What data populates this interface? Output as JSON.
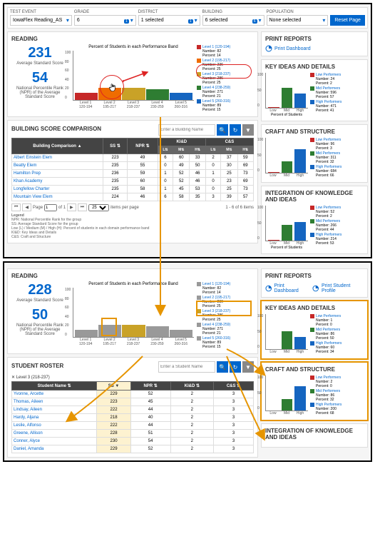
{
  "filters": {
    "test_event": {
      "label": "TEST EVENT",
      "value": "IowaFlex Reading_AS"
    },
    "grade": {
      "label": "GRADE",
      "value": "6",
      "badge": "1"
    },
    "district": {
      "label": "DISTRICT",
      "value": "1 selected",
      "badge": "1"
    },
    "building": {
      "label": "BUILDING",
      "value": "6 selected",
      "badge": "6"
    },
    "population": {
      "label": "POPULATION",
      "value": "None selected"
    },
    "reset": "Reset Page"
  },
  "top": {
    "reading_title": "READING",
    "avg_score": "231",
    "avg_label": "Average Standard Score",
    "npr": "54",
    "npr_label": "National Percentile Rank (NPR) of the Average Standard Score",
    "chart_title": "Percent of Students in each Performance Band",
    "levels": [
      {
        "name": "Level 1 (120-194)",
        "range": "120-194",
        "number": "82",
        "percent": "14",
        "color": "#c62828",
        "height": 14
      },
      {
        "name": "Level 2 (195-217)",
        "range": "195-217",
        "number": "236",
        "percent": "25",
        "color": "#ef6c00",
        "height": 25
      },
      {
        "name": "Level 3 (218-237)",
        "range": "218-237",
        "number": "286",
        "percent": "25",
        "color": "#c9a227",
        "height": 25
      },
      {
        "name": "Level 4 (238-259)",
        "range": "230-259",
        "number": "271",
        "percent": "21",
        "color": "#2e7d32",
        "height": 21
      },
      {
        "name": "Level 5 (260-316)",
        "range": "260-316",
        "number": "89",
        "percent": "15",
        "color": "#1565c0",
        "height": 15
      }
    ],
    "bsc_title": "BUILDING SCORE COMPARISON",
    "search_ph": "Enter a Building Name",
    "cols": {
      "building": "Building Comparison",
      "ss": "SS",
      "npr": "NPR",
      "kid": "KI&D",
      "cs": "C&S",
      "l": "L",
      "m": "M",
      "h": "H"
    },
    "rows": [
      {
        "name": "Albert Einstein Elem",
        "ss": "223",
        "npr": "49",
        "kl": "6",
        "km": "60",
        "kh": "33",
        "cl": "2",
        "cm": "37",
        "ch": "59"
      },
      {
        "name": "Beatty Elem",
        "ss": "235",
        "npr": "55",
        "kl": "0",
        "km": "49",
        "kh": "50",
        "cl": "0",
        "cm": "30",
        "ch": "69"
      },
      {
        "name": "Hamilton Prep",
        "ss": "236",
        "npr": "59",
        "kl": "1",
        "km": "52",
        "kh": "46",
        "cl": "1",
        "cm": "25",
        "ch": "73"
      },
      {
        "name": "Khan Academy",
        "ss": "235",
        "npr": "60",
        "kl": "0",
        "km": "52",
        "kh": "46",
        "cl": "0",
        "cm": "23",
        "ch": "69"
      },
      {
        "name": "Longfellow Charter",
        "ss": "235",
        "npr": "58",
        "kl": "1",
        "km": "45",
        "kh": "53",
        "cl": "0",
        "cm": "25",
        "ch": "73"
      },
      {
        "name": "Mountain View Elem",
        "ss": "224",
        "npr": "46",
        "kl": "6",
        "km": "58",
        "kh": "35",
        "cl": "3",
        "cm": "39",
        "ch": "57"
      }
    ],
    "pager": {
      "page": "Page",
      "of": "of 1",
      "ipp": "items per page",
      "count": "1 - 6 of 6 items",
      "ppv": "25",
      "pg": "1"
    },
    "legend_title": "Legend",
    "legend_lines": [
      "NPR: National Percentile Rank for the group",
      "SS: Average Standard Score for the group",
      "Low (L) / Medium (M) / High (H): Percent of students in each domain performance band",
      "KI&D: Key Ideas and Details",
      "C&S: Craft and Structure"
    ],
    "print_title": "PRINT REPORTS",
    "print_dash": "Print Dashboard",
    "key_ideas": {
      "title": "KEY IDEAS AND DETAILS",
      "xlabel": "Percent of Students",
      "perf": [
        {
          "name": "Low Performers",
          "number": "24",
          "percent": "2",
          "color": "#c62828",
          "h": 2
        },
        {
          "name": "Mid Performers",
          "number": "596",
          "percent": "57",
          "color": "#2e7d32",
          "h": 57
        },
        {
          "name": "High Performers",
          "number": "471",
          "percent": "41",
          "color": "#1565c0",
          "h": 41
        }
      ],
      "xlabels": [
        "Low",
        "Mid",
        "High"
      ]
    },
    "craft": {
      "title": "CRAFT AND STRUCTURE",
      "perf": [
        {
          "name": "Low Performers",
          "number": "96",
          "percent": "3",
          "color": "#c62828",
          "h": 3
        },
        {
          "name": "Mid Performers",
          "number": "311",
          "percent": "32",
          "color": "#2e7d32",
          "h": 32
        },
        {
          "name": "High Performers",
          "number": "684",
          "percent": "66",
          "color": "#1565c0",
          "h": 66
        }
      ]
    },
    "integ": {
      "title": "INTEGRATION OF KNOWLEDGE AND IDEAS",
      "perf": [
        {
          "name": "Low Performers",
          "number": "52",
          "percent": "2",
          "color": "#c62828",
          "h": 2
        },
        {
          "name": "Mid Performers",
          "number": "266",
          "percent": "44",
          "color": "#2e7d32",
          "h": 44
        },
        {
          "name": "High Performers",
          "number": "214",
          "percent": "53",
          "color": "#1565c0",
          "h": 53
        }
      ]
    }
  },
  "bottom": {
    "avg_score": "228",
    "npr": "50",
    "levels": [
      {
        "name": "Level 1 (120-194)",
        "range": "120-194",
        "number": "82",
        "percent": "14",
        "color": "#999",
        "height": 14
      },
      {
        "name": "Level 2 (195-217)",
        "range": "195-217",
        "number": "236",
        "percent": "25",
        "color": "#999",
        "height": 25
      },
      {
        "name": "Level 3 (218-237)",
        "range": "218-237",
        "number": "286",
        "percent": "25",
        "color": "#c9a227",
        "height": 25
      },
      {
        "name": "Level 4 (238-259)",
        "range": "230-259",
        "number": "271",
        "percent": "21",
        "color": "#999",
        "height": 21
      },
      {
        "name": "Level 5 (260-316)",
        "range": "260-316",
        "number": "89",
        "percent": "15",
        "color": "#999",
        "height": 15
      }
    ],
    "roster_title": "STUDENT ROSTER",
    "roster_filter": "Level 3 (218-237)",
    "search_ph": "Enter a Student Name",
    "cols": {
      "name": "Student Name",
      "ss": "SS",
      "npr": "NPR",
      "kid": "KI&D",
      "cs": "C&S"
    },
    "rows": [
      {
        "name": "Yvonne, Arcette",
        "ss": "229",
        "npr": "52",
        "kid": "2",
        "cs": "3"
      },
      {
        "name": "Thomas, Aileen",
        "ss": "223",
        "npr": "45",
        "kid": "2",
        "cs": "3"
      },
      {
        "name": "Lindsay, Aileen",
        "ss": "222",
        "npr": "44",
        "kid": "2",
        "cs": "3"
      },
      {
        "name": "Hardy, Aljana",
        "ss": "218",
        "npr": "40",
        "kid": "2",
        "cs": "3"
      },
      {
        "name": "Leslie, Alfonso",
        "ss": "222",
        "npr": "44",
        "kid": "2",
        "cs": "3"
      },
      {
        "name": "Greene, Allison",
        "ss": "228",
        "npr": "51",
        "kid": "2",
        "cs": "3"
      },
      {
        "name": "Conner, Alyce",
        "ss": "230",
        "npr": "54",
        "kid": "2",
        "cs": "3"
      },
      {
        "name": "Daniel, Amanda",
        "ss": "229",
        "npr": "52",
        "kid": "2",
        "cs": "3"
      }
    ],
    "print_profile": "Print Student Profile",
    "key_ideas": {
      "title": "KEY IDEAS AND DETAILS",
      "perf": [
        {
          "name": "Low Performers",
          "number": "1",
          "percent": "0",
          "color": "#c62828",
          "h": 0
        },
        {
          "name": "Mid Performers",
          "number": "86",
          "percent": "50",
          "color": "#2e7d32",
          "h": 50
        },
        {
          "name": "High Performers",
          "number": "60",
          "percent": "34",
          "color": "#1565c0",
          "h": 34
        }
      ]
    },
    "craft": {
      "title": "CRAFT AND STRUCTURE",
      "perf": [
        {
          "name": "Low Performers",
          "number": "2",
          "percent": "0",
          "color": "#c62828",
          "h": 0
        },
        {
          "name": "Mid Performers",
          "number": "86",
          "percent": "32",
          "color": "#2e7d32",
          "h": 32
        },
        {
          "name": "High Performers",
          "number": "200",
          "percent": "68",
          "color": "#1565c0",
          "h": 68
        }
      ]
    },
    "integ_title": "INTEGRATION OF KNOWLEDGE AND IDEAS"
  },
  "chart_data": [
    {
      "type": "bar",
      "title": "Percent of Students in each Performance Band",
      "categories": [
        "Level 1",
        "Level 2",
        "Level 3",
        "Level 4",
        "Level 5"
      ],
      "values": [
        14,
        25,
        25,
        21,
        15
      ],
      "ylim": [
        0,
        100
      ]
    },
    {
      "type": "bar",
      "title": "KEY IDEAS AND DETAILS (top)",
      "categories": [
        "Low",
        "Mid",
        "High"
      ],
      "values": [
        2,
        57,
        41
      ],
      "ylim": [
        0,
        100
      ]
    },
    {
      "type": "bar",
      "title": "CRAFT AND STRUCTURE (top)",
      "categories": [
        "Low",
        "Mid",
        "High"
      ],
      "values": [
        3,
        32,
        66
      ],
      "ylim": [
        0,
        100
      ]
    },
    {
      "type": "bar",
      "title": "INTEGRATION OF KNOWLEDGE AND IDEAS (top)",
      "categories": [
        "Low",
        "Mid",
        "High"
      ],
      "values": [
        2,
        44,
        53
      ],
      "ylim": [
        0,
        100
      ]
    },
    {
      "type": "bar",
      "title": "Percent of Students in each Performance Band (filtered)",
      "categories": [
        "Level 1",
        "Level 2",
        "Level 3",
        "Level 4",
        "Level 5"
      ],
      "values": [
        14,
        25,
        25,
        21,
        15
      ],
      "ylim": [
        0,
        100
      ]
    },
    {
      "type": "bar",
      "title": "KEY IDEAS AND DETAILS (bottom)",
      "categories": [
        "Low",
        "Mid",
        "High"
      ],
      "values": [
        0,
        50,
        34
      ],
      "ylim": [
        0,
        100
      ]
    },
    {
      "type": "bar",
      "title": "CRAFT AND STRUCTURE (bottom)",
      "categories": [
        "Low",
        "Mid",
        "High"
      ],
      "values": [
        0,
        32,
        68
      ],
      "ylim": [
        0,
        100
      ]
    }
  ]
}
